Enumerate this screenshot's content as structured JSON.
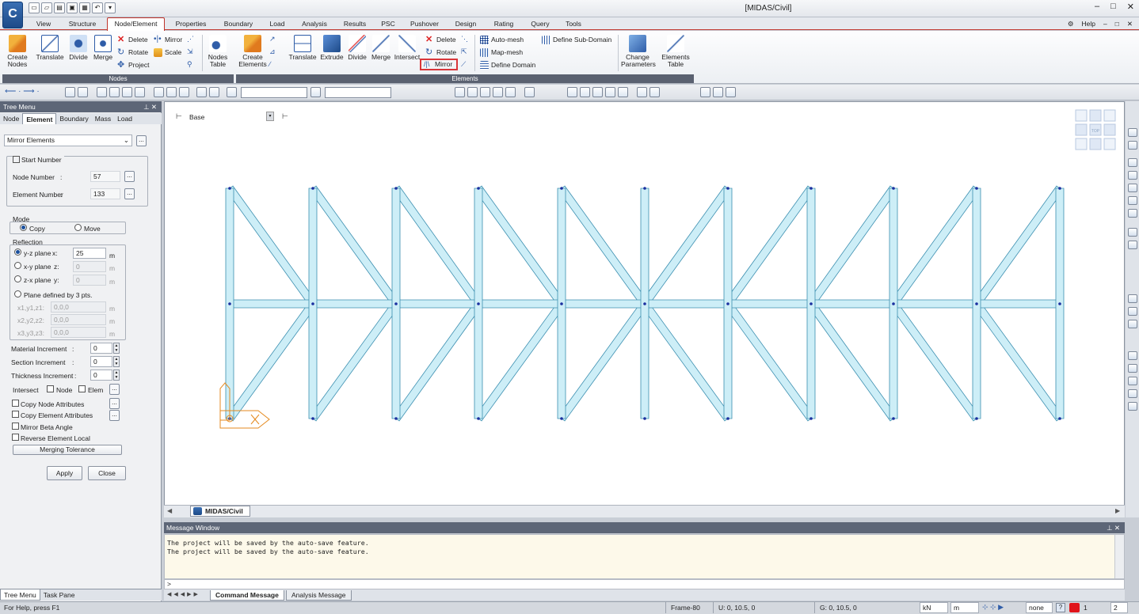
{
  "app": {
    "title": "[MIDAS/Civil]",
    "logo": "C"
  },
  "window_controls": [
    "–",
    "□",
    "✕"
  ],
  "ribbon_tabs": [
    "View",
    "Structure",
    "Node/Element",
    "Properties",
    "Boundary",
    "Load",
    "Analysis",
    "Results",
    "PSC",
    "Pushover",
    "Design",
    "Rating",
    "Query",
    "Tools"
  ],
  "active_tab": "Node/Element",
  "help_label": "Help",
  "ribbon": {
    "nodes_group": {
      "label": "Nodes",
      "create": "Create",
      "create2": "Nodes",
      "translate": "Translate",
      "divide": "Divide",
      "merge": "Merge",
      "delete": "Delete",
      "rotate": "Rotate",
      "project": "Project",
      "mirror": "Mirror",
      "scale": "Scale",
      "table": "Nodes",
      "table2": "Table"
    },
    "elements_group": {
      "label": "Elements",
      "create": "Create",
      "create2": "Elements",
      "translate": "Translate",
      "extrude": "Extrude",
      "divide": "Divide",
      "merge": "Merge",
      "intersect": "Intersect",
      "delete": "Delete",
      "rotate": "Rotate",
      "mirror": "Mirror",
      "automesh": "Auto-mesh",
      "mapmesh": "Map-mesh",
      "define_domain": "Define Domain",
      "define_subdomain": "Define Sub-Domain",
      "change": "Change",
      "change2": "Parameters",
      "table": "Elements",
      "table2": "Table"
    }
  },
  "tree_menu": {
    "title": "Tree Menu",
    "tabs": [
      "Node",
      "Element",
      "Boundary",
      "Mass",
      "Load"
    ],
    "active_tab": "Element",
    "function_select": "Mirror Elements",
    "start_number_label": "Start Number",
    "node_number_label": "Node Number",
    "node_number": "57",
    "element_number_label": "Element Number",
    "element_number": "133",
    "mode_label": "Mode",
    "mode_copy": "Copy",
    "mode_move": "Move",
    "reflection_label": "Reflection",
    "yz_label": "y-z plane",
    "yz_axis": "x:",
    "yz_value": "25",
    "xy_label": "x-y plane",
    "xy_axis": "z:",
    "xy_value": "0",
    "zx_label": "z-x plane",
    "zx_axis": "y:",
    "zx_value": "0",
    "unit_m": "m",
    "plane3_label": "Plane defined by 3 pts.",
    "p1_label": "x1,y1,z1:",
    "p1_value": "0,0,0",
    "p2_label": "x2,y2,z2:",
    "p2_value": "0,0,0",
    "p3_label": "x3,y3,z3:",
    "p3_value": "0,0,0",
    "material_inc_label": "Material Increment",
    "material_inc": "0",
    "section_inc_label": "Section Increment",
    "section_inc": "0",
    "thickness_inc_label": "Thickness Increment",
    "thickness_inc": "0",
    "colon": ":",
    "intersect_label": "Intersect",
    "intersect_node": "Node",
    "intersect_elem": "Elem",
    "copy_node_attr": "Copy Node Attributes",
    "copy_elem_attr": "Copy Element Attributes",
    "mirror_beta": "Mirror Beta Angle",
    "reverse_local": "Reverse Element Local",
    "merging_tolerance": "Merging Tolerance",
    "apply": "Apply",
    "close": "Close",
    "ellipsis": "...",
    "bottom_tabs": [
      "Tree Menu",
      "Task Pane"
    ]
  },
  "view": {
    "base_label": "Base",
    "tab_label": "MIDAS/Civil",
    "cube_label": "TOP"
  },
  "message_window": {
    "title": "Message Window",
    "lines": [
      "The project will be saved by the auto-save feature.",
      "The project will be saved by the auto-save feature."
    ],
    "prompt": ">",
    "tabs": [
      "Command Message",
      "Analysis Message"
    ]
  },
  "status": {
    "help": "For Help, press F1",
    "frame": "Frame-80",
    "u_coord": "U: 0, 10.5, 0",
    "g_coord": "G: 0, 10.5, 0",
    "force_unit": "kN",
    "length_unit": "m",
    "snap": "none",
    "num1": "1",
    "num2": "2"
  },
  "colors": {
    "accent": "#c0342b",
    "member_fill": "#cdeef7",
    "member_stroke": "#3c8fb0",
    "node": "#1b2fa0",
    "axis": "#e58a1f"
  }
}
